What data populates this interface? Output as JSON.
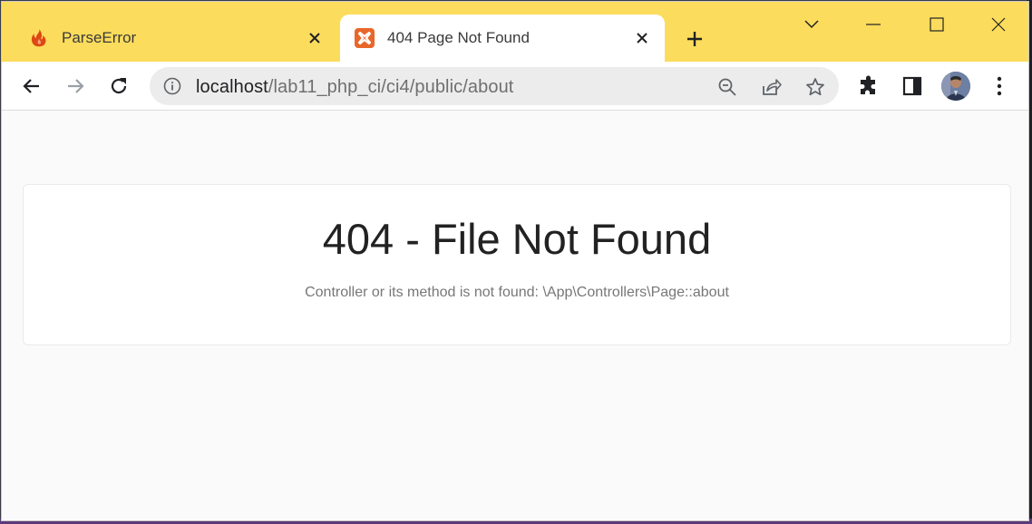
{
  "tabs": [
    {
      "title": "ParseError",
      "active": false,
      "favicon": "codeigniter-flame-icon"
    },
    {
      "title": "404 Page Not Found",
      "active": true,
      "favicon": "xampp-icon"
    }
  ],
  "address_bar": {
    "host": "localhost",
    "path": "/lab11_php_ci/ci4/public/about"
  },
  "page": {
    "heading": "404 - File Not Found",
    "message": "Controller or its method is not found: \\App\\Controllers\\Page::about"
  },
  "colors": {
    "tabstrip": "#fcdc5c",
    "xampp_orange": "#e8672a",
    "codeigniter_red": "#dd4814"
  }
}
